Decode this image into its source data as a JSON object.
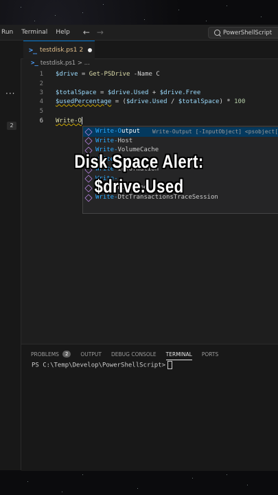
{
  "menu": {
    "items": [
      "Run",
      "Terminal",
      "Help"
    ]
  },
  "command_center": {
    "label": "PowerShellScript"
  },
  "activity_bar": {
    "overflow": "···",
    "badge": "2"
  },
  "tab": {
    "name": "testdisk.ps1",
    "problems": "2"
  },
  "breadcrumb": {
    "path": "testdisk.ps1 > ..."
  },
  "editor": {
    "lines": [
      {
        "num": "1",
        "parts": [
          [
            "var",
            "$drive"
          ],
          [
            "op",
            " = "
          ],
          [
            "cmdlet",
            "Get-PSDrive"
          ],
          [
            "param",
            " -Name C"
          ]
        ]
      },
      {
        "num": "2",
        "parts": []
      },
      {
        "num": "3",
        "parts": [
          [
            "var",
            "$totalSpace"
          ],
          [
            "op",
            " = "
          ],
          [
            "var",
            "$drive.Used"
          ],
          [
            "op",
            " + "
          ],
          [
            "var",
            "$drive.Free"
          ]
        ]
      },
      {
        "num": "4",
        "parts": [
          [
            "var squiggle",
            "$usedPercentage"
          ],
          [
            "op",
            " = ("
          ],
          [
            "var",
            "$drive.Used"
          ],
          [
            "op",
            " / "
          ],
          [
            "var",
            "$totalSpace"
          ],
          [
            "op",
            ") * "
          ],
          [
            "num",
            "100"
          ]
        ]
      },
      {
        "num": "5",
        "parts": []
      },
      {
        "num": "6",
        "parts": [
          [
            "cmdlet squiggle",
            "Write-O"
          ]
        ]
      }
    ]
  },
  "suggestions": [
    {
      "match": "Write-O",
      "rest": "utput",
      "detail": "Write-Output [-InputObject] <psobject[]>",
      "selected": true
    },
    {
      "match": "Write-",
      "rest": "Host"
    },
    {
      "match": "Write-",
      "rest": "VolumeCache"
    },
    {
      "match": "Write-",
      "rest": ""
    },
    {
      "match": "Write-",
      "rest": "Information"
    },
    {
      "match": "Write-",
      "rest": ""
    },
    {
      "match": "Write-",
      "rest": "EventLog"
    },
    {
      "match": "Write-",
      "rest": "DtcTransactionsTraceSession"
    }
  ],
  "caption": {
    "line1": "Disk Space Alert:",
    "line2": "$drive.Used"
  },
  "panel": {
    "tabs": [
      "PROBLEMS",
      "OUTPUT",
      "DEBUG CONSOLE",
      "TERMINAL",
      "PORTS"
    ],
    "problems_count": "2",
    "active_tab": "TERMINAL",
    "prompt": "PS C:\\Temp\\Develop\\PowerShellScript>"
  }
}
